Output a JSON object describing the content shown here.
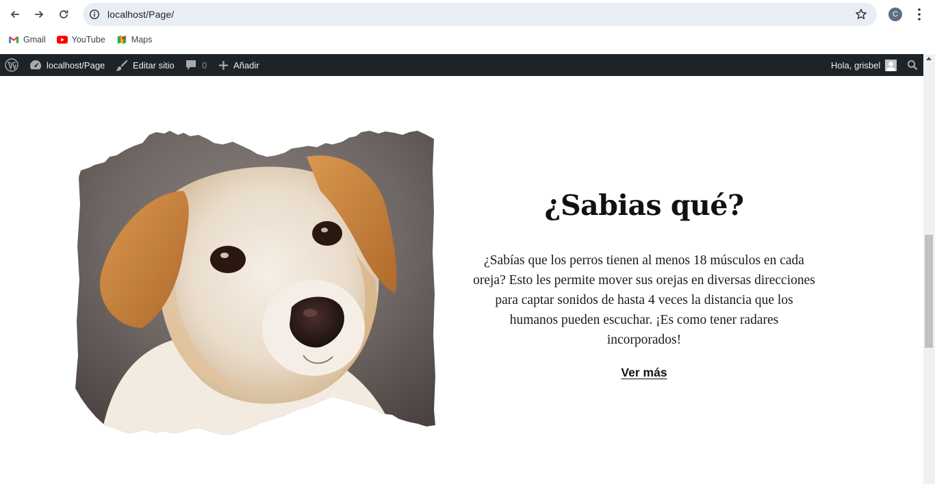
{
  "browser": {
    "url": "localhost/Page/",
    "profile_initial": "C",
    "bookmarks": [
      {
        "label": "Gmail",
        "icon": "gmail-icon"
      },
      {
        "label": "YouTube",
        "icon": "youtube-icon"
      },
      {
        "label": "Maps",
        "icon": "maps-icon"
      }
    ]
  },
  "adminbar": {
    "site": "localhost/Page",
    "edit": "Editar sitio",
    "comments_count": "0",
    "add_new": "Añadir",
    "greeting": "Hola, grisbel"
  },
  "content": {
    "title": "¿Sabias qué?",
    "body": "¿Sabías que los perros tienen al menos 18 músculos en cada oreja? Esto les permite mover sus orejas en diversas direcciones para captar sonidos de hasta 4 veces la distancia que los humanos pueden escuchar. ¡Es como tener radares incorporados!",
    "link": "Ver más"
  },
  "colors": {
    "adminbar_bg": "#1d2327",
    "omnibox_bg": "#e9edf6"
  }
}
